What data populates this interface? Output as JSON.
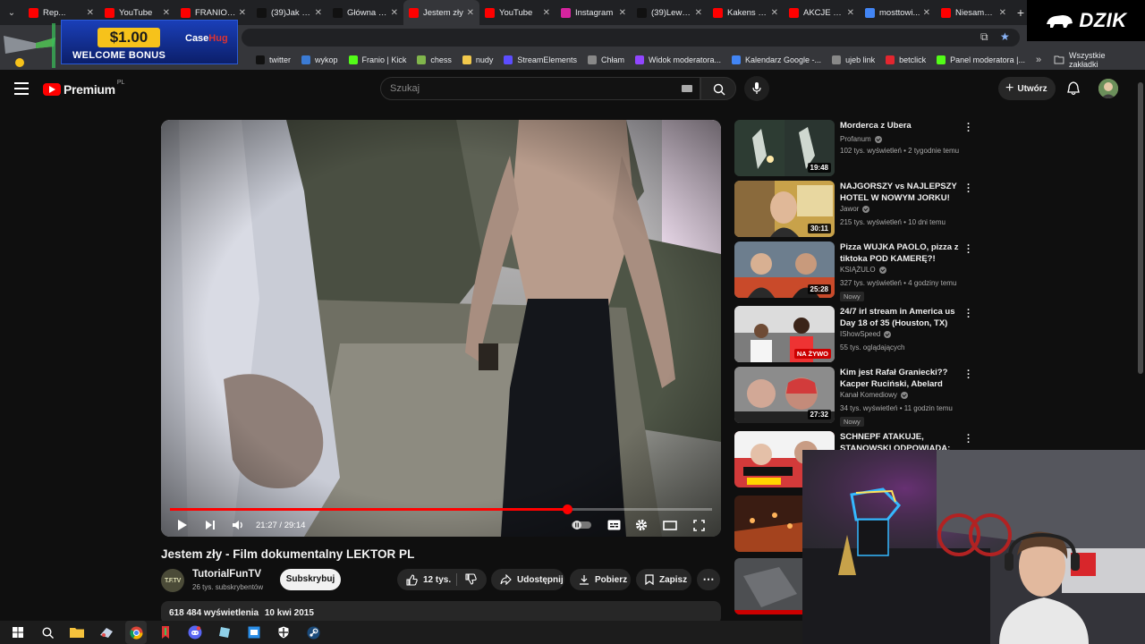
{
  "browser": {
    "tabs": [
      {
        "label": "Rep...",
        "favicon_color": "#ff0000"
      },
      {
        "label": "YouTube",
        "favicon_color": "#ff0000"
      },
      {
        "label": "FRANIO | J...",
        "favicon_color": "#ff0000"
      },
      {
        "label": "(39)Jak po...",
        "favicon_color": "#111111"
      },
      {
        "label": "Główna / X",
        "favicon_color": "#111111"
      },
      {
        "label": "Jestem zły",
        "favicon_color": "#ff0000",
        "active": true
      },
      {
        "label": "YouTube",
        "favicon_color": "#ff0000"
      },
      {
        "label": "Instagram",
        "favicon_color": "#d6249f"
      },
      {
        "label": "(39)Lewan...",
        "favicon_color": "#111111"
      },
      {
        "label": "Kakens tw...",
        "favicon_color": "#ff0000"
      },
      {
        "label": "AKCJE VIP...",
        "favicon_color": "#ff0000"
      },
      {
        "label": "mosttowi...",
        "favicon_color": "#4285f4"
      },
      {
        "label": "Niesamow...",
        "favicon_color": "#ff0000"
      }
    ],
    "bookmarks": [
      {
        "label": "twitter",
        "color": "#111111"
      },
      {
        "label": "wykop",
        "color": "#3b7bd4"
      },
      {
        "label": "Franio | Kick",
        "color": "#53fc18"
      },
      {
        "label": "chess",
        "color": "#81b64c"
      },
      {
        "label": "nudy",
        "color": "#f2c94c"
      },
      {
        "label": "StreamElements",
        "color": "#5c4dff"
      },
      {
        "label": "Chłam",
        "color": "#888888"
      },
      {
        "label": "Widok moderatora...",
        "color": "#9146ff"
      },
      {
        "label": "Kalendarz Google -...",
        "color": "#4285f4"
      },
      {
        "label": "ujeb link",
        "color": "#888888"
      },
      {
        "label": "betclick",
        "color": "#e3262f"
      },
      {
        "label": "Panel moderatora |...",
        "color": "#53fc18"
      }
    ],
    "all_bookmarks": "Wszystkie zakładki"
  },
  "ad": {
    "amount": "$1.00",
    "bonus": "WELCOME BONUS",
    "brand_a": "Case",
    "brand_b": "Hug"
  },
  "overlay_logo": "DZIK",
  "youtube": {
    "logo": "Premium",
    "logo_region": "PL",
    "search_placeholder": "Szukaj",
    "create_label": "Utwórz"
  },
  "player": {
    "time": "21:27 / 29:14",
    "progress": 0.733
  },
  "video": {
    "title": "Jestem zły - Film dokumentalny LEKTOR PL",
    "channel": "TutorialFunTV",
    "channel_avatar_text": "T.F.TV",
    "subscribers": "26 tys. subskrybentów",
    "subscribe_label": "Subskrybuj",
    "likes": "12 tys.",
    "share_label": "Udostępnij",
    "download_label": "Pobierz",
    "save_label": "Zapisz",
    "views": "618 484 wyświetlenia",
    "date": "10 kwi 2015"
  },
  "recommendations": [
    {
      "title": "Morderca z Ubera",
      "channel": "Profanum",
      "verified": true,
      "meta": "102 tys. wyświetleń • 2 tygodnie temu",
      "duration": "19:48",
      "new": ""
    },
    {
      "title": "NAJGORSZY vs NAJLEPSZY HOTEL W NOWYM JORKU! *zł...",
      "channel": "Jawor",
      "verified": true,
      "meta": "215 tys. wyświetleń • 10 dni temu",
      "duration": "30:11",
      "new": ""
    },
    {
      "title": "Pizza WUJKA PAOLO, pizza z tiktoka POD KAMERĘ?!",
      "channel": "KSIĄŻULO",
      "verified": true,
      "meta": "327 tys. wyświetleń • 4 godziny temu",
      "duration": "25:28",
      "new": "Nowy"
    },
    {
      "title": "24/7 irl stream in America us Day 18 of 35 (Houston, TX)",
      "channel": "IShowSpeed",
      "verified": true,
      "meta": "55 tys. oglądających",
      "duration": "",
      "live": "NA ŻYWO",
      "new": ""
    },
    {
      "title": "Kim jest Rafał Graniecki?? Kacper Ruciński, Abelard Giza,...",
      "channel": "Kanał Komediowy",
      "verified": true,
      "meta": "34 tys. wyświetleń • 11 godzin temu",
      "duration": "27:32",
      "new": "Nowy"
    },
    {
      "title": "SCHNEPF ATAKUJE, STANOWSKI ODPOWIADA:",
      "channel": "",
      "verified": false,
      "meta": "",
      "duration": "",
      "new": ""
    }
  ],
  "colors": {
    "accent": "#ff0000",
    "bg": "#0f0f0f",
    "chip": "#272727"
  }
}
